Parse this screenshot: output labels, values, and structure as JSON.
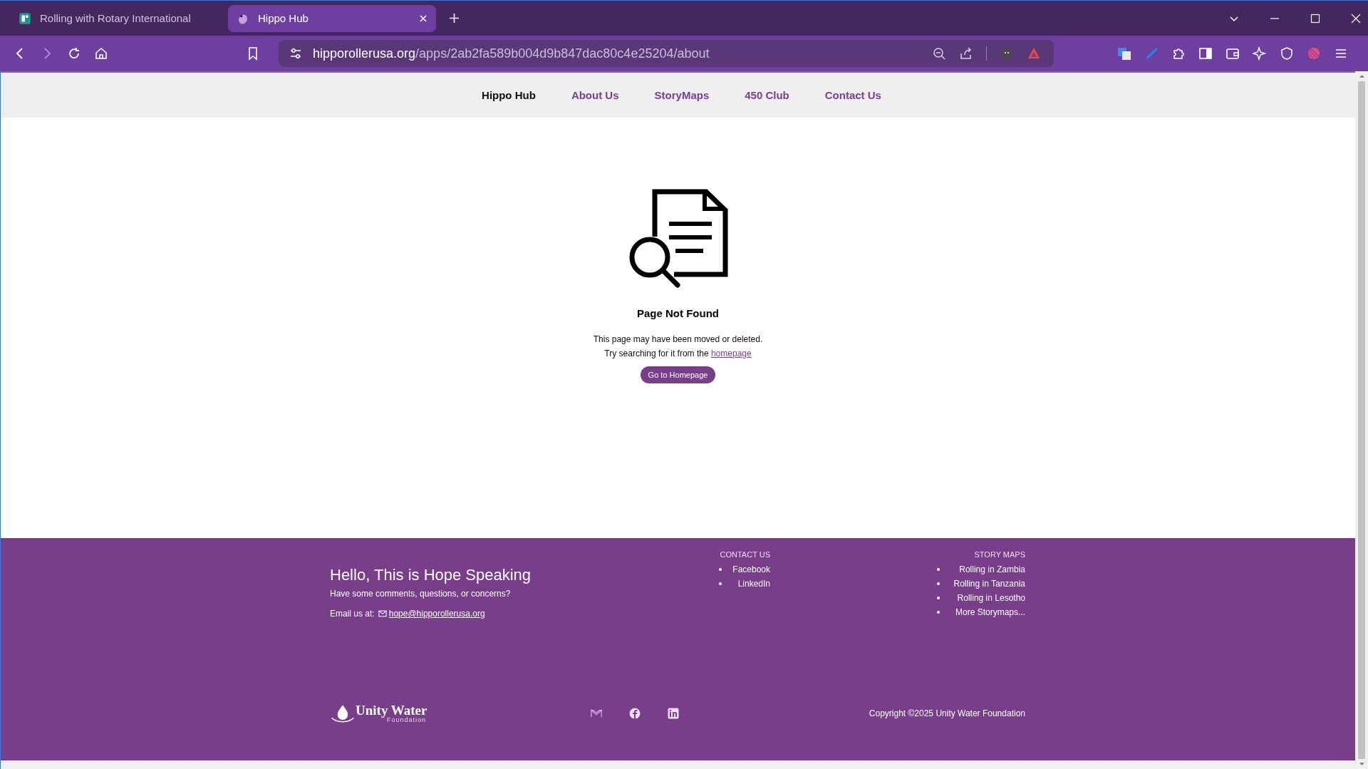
{
  "browser": {
    "tabs": [
      {
        "title": "Rolling with Rotary International",
        "selected": false
      },
      {
        "title": "Hippo Hub",
        "selected": true
      }
    ],
    "url": {
      "host": "hipporollerusa.org",
      "path": "/apps/2ab2fa589b004d9b847dac80c4e25204/about"
    }
  },
  "nav": [
    {
      "label": "Hippo Hub",
      "kind": "brand"
    },
    {
      "label": "About Us",
      "kind": "link"
    },
    {
      "label": "StoryMaps",
      "kind": "link"
    },
    {
      "label": "450 Club",
      "kind": "link"
    },
    {
      "label": "Contact Us",
      "kind": "link"
    }
  ],
  "not_found": {
    "title": "Page Not Found",
    "line_1": "This page may have been moved or deleted.",
    "line_2": "Try searching for it from the",
    "link": "homepage",
    "button": "Go to Homepage"
  },
  "footer": {
    "heading": "Hello, This is Hope Speaking",
    "subheading": "Have some comments, questions, or concerns?",
    "email_label": "Email us at:",
    "email": "hope@hipporollerusa.org",
    "contact": {
      "title": "CONTACT US",
      "items": [
        "Facebook",
        "LinkedIn"
      ]
    },
    "story_maps": {
      "title": "STORY MAPS",
      "items": [
        "Rolling in Zambia",
        "Rolling in Tanzania",
        "Rolling in Lesotho",
        "More Storymaps..."
      ]
    },
    "logo": {
      "name": "Unity Water",
      "tagline": "Foundation"
    },
    "copyright": "Copyright ©2025 Unity Water Foundation"
  }
}
